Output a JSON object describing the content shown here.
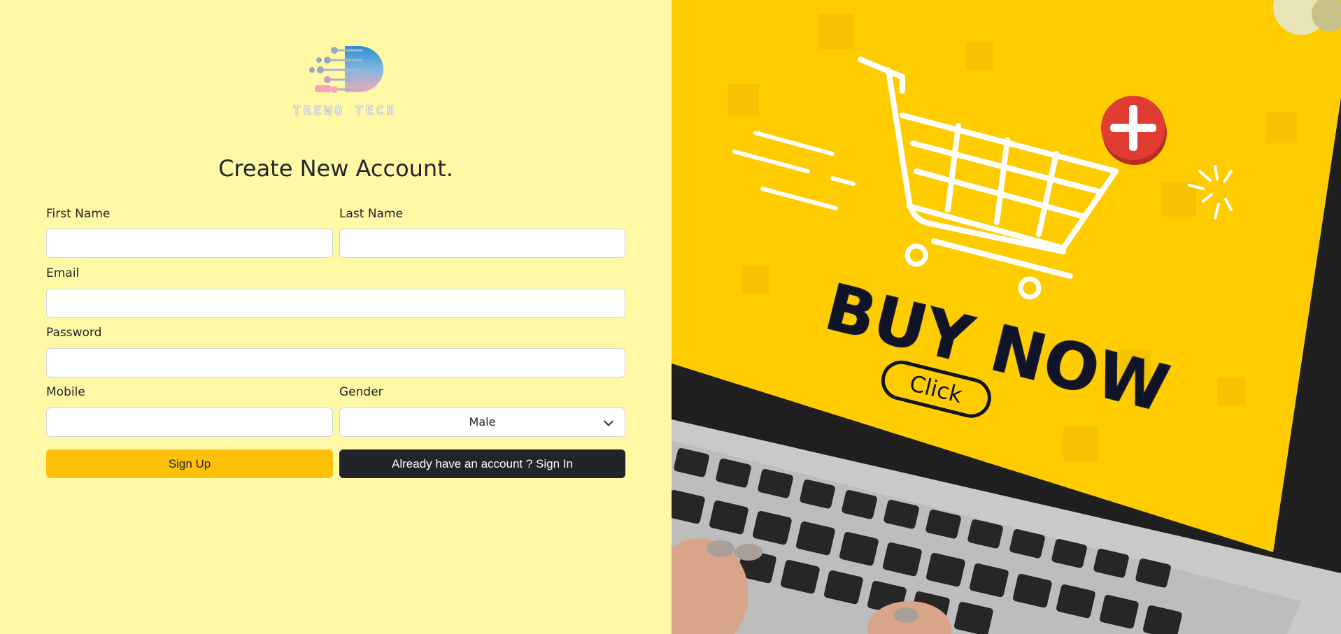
{
  "brand": {
    "name": "TREWO TECH"
  },
  "form": {
    "title": "Create New Account.",
    "first_name_label": "First Name",
    "first_name_value": "",
    "last_name_label": "Last Name",
    "last_name_value": "",
    "email_label": "Email",
    "email_value": "",
    "password_label": "Password",
    "password_value": "",
    "mobile_label": "Mobile",
    "mobile_value": "",
    "gender_label": "Gender",
    "gender_selected": "Male",
    "signup_label": "Sign Up",
    "signin_label": "Already have an account ? Sign In"
  },
  "hero": {
    "headline": "BUY NOW",
    "button_text": "Click"
  },
  "colors": {
    "page_bg": "#fff9a6",
    "accent": "#ffc107",
    "dark": "#212529",
    "hero_yellow": "#ffcc00",
    "hero_red": "#e03c31"
  },
  "icons": [
    "logo-icon",
    "chevron-down-icon",
    "shopping-cart-icon",
    "plus-icon"
  ]
}
